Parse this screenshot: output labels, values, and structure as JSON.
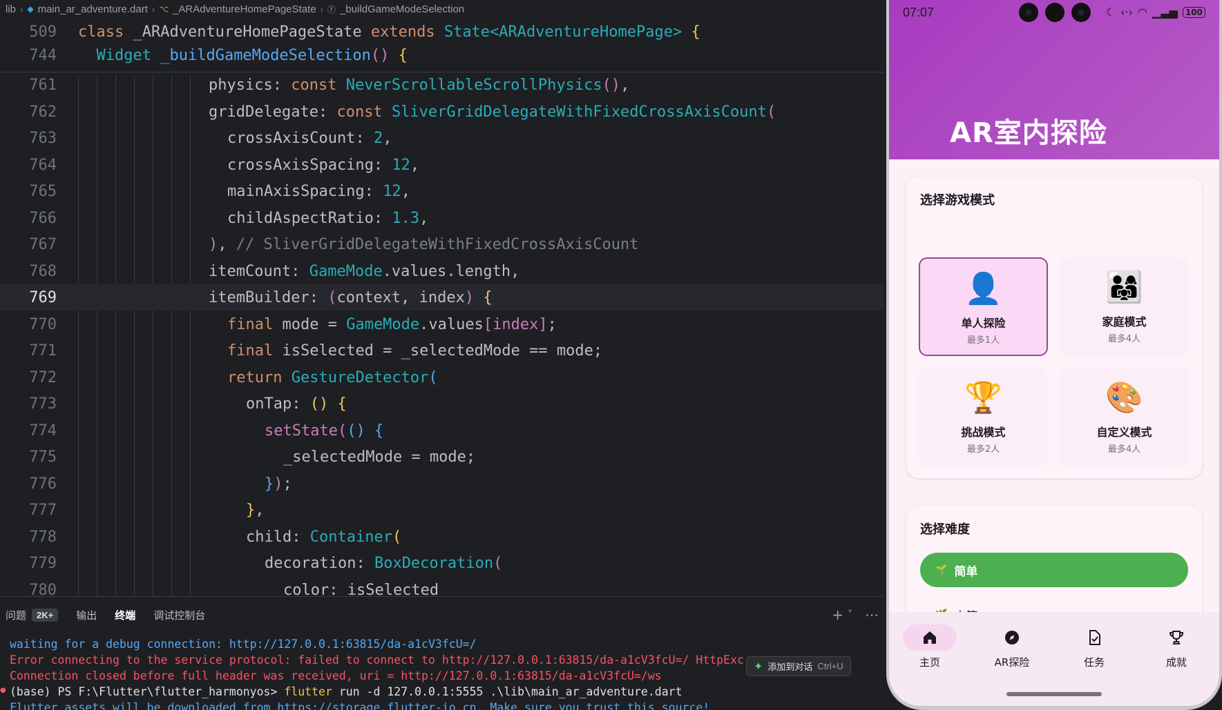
{
  "breadcrumb": {
    "root": "lib",
    "file": "main_ar_adventure.dart",
    "class": "_ARAdventureHomePageState",
    "method": "_buildGameModeSelection"
  },
  "code": {
    "sticky": [
      {
        "ln": "509",
        "text": "class _ARAdventureHomePageState extends State<ARAdventureHomePage> {"
      },
      {
        "ln": "744",
        "text": "  Widget _buildGameModeSelection() {"
      }
    ],
    "lines": [
      {
        "ln": "761"
      },
      {
        "ln": "762"
      },
      {
        "ln": "763"
      },
      {
        "ln": "764"
      },
      {
        "ln": "765"
      },
      {
        "ln": "766"
      },
      {
        "ln": "767"
      },
      {
        "ln": "768"
      },
      {
        "ln": "769"
      },
      {
        "ln": "770"
      },
      {
        "ln": "771"
      },
      {
        "ln": "772"
      },
      {
        "ln": "773"
      },
      {
        "ln": "774"
      },
      {
        "ln": "775"
      },
      {
        "ln": "776"
      },
      {
        "ln": "777"
      },
      {
        "ln": "778"
      },
      {
        "ln": "779"
      },
      {
        "ln": "780"
      }
    ],
    "tokens": {
      "t509_kw": "class",
      "t509_cls": " _ARAdventureHomePageState ",
      "t509_ext": "extends",
      "t509_st": " State<ARAdventureHomePage> ",
      "t509_b": "{",
      "t744_ty": "Widget",
      "t744_fn": " _buildGameModeSelection",
      "t744_p": "()",
      "t744_b": " {",
      "t761_a": "physics",
      "t761_b": ": ",
      "t761_c": "const",
      "t761_d": " NeverScrollableScrollPhysics",
      "t761_e": "()",
      "t761_f": ",",
      "t762_a": "gridDelegate",
      "t762_b": ": ",
      "t762_c": "const",
      "t762_d": " SliverGridDelegateWithFixedCrossAxisCount",
      "t762_e": "(",
      "t763_a": "crossAxisCount",
      "t763_b": ": ",
      "t763_c": "2",
      "t763_d": ",",
      "t764_a": "crossAxisSpacing",
      "t764_b": ": ",
      "t764_c": "12",
      "t764_d": ",",
      "t765_a": "mainAxisSpacing",
      "t765_b": ": ",
      "t765_c": "12",
      "t765_d": ",",
      "t766_a": "childAspectRatio",
      "t766_b": ": ",
      "t766_c": "1.3",
      "t766_d": ",",
      "t767_a": ")",
      "t767_b": ", ",
      "t767_c": "// SliverGridDelegateWithFixedCrossAxisCount",
      "t768_a": "itemCount",
      "t768_b": ": ",
      "t768_c": "GameMode",
      "t768_d": ".values.length,",
      "t769_a": "itemBuilder",
      "t769_b": ": ",
      "t769_c": "(",
      "t769_d": "context, index",
      "t769_e": ")",
      "t769_f": " {",
      "t770_a": "final",
      "t770_b": " mode = ",
      "t770_c": "GameMode",
      "t770_d": ".values",
      "t770_e": "[",
      "t770_f": "index",
      "t770_g": "]",
      "t770_h": ";",
      "t771_a": "final",
      "t771_b": " isSelected = _selectedMode == mode;",
      "t772_a": "return",
      "t772_b": " GestureDetector",
      "t772_c": "(",
      "t773_a": "onTap",
      "t773_b": ": ",
      "t773_c": "()",
      "t773_d": " {",
      "t774_a": "setState",
      "t774_b": "(",
      "t774_c": "()",
      "t774_d": " {",
      "t775_a": "_selectedMode = mode;",
      "t776_a": "}",
      "t776_b": ")",
      "t776_c": ";",
      "t777_a": "}",
      "t777_b": ",",
      "t778_a": "child",
      "t778_b": ": ",
      "t778_c": "Container",
      "t778_d": "(",
      "t779_a": "decoration",
      "t779_b": ": ",
      "t779_c": "BoxDecoration",
      "t779_d": "(",
      "t780_a": "color",
      "t780_b": ": isSelected"
    }
  },
  "panel": {
    "tabs": [
      {
        "label": "问题",
        "badge": "2K+"
      },
      {
        "label": "输出"
      },
      {
        "label": "终端",
        "active": true
      },
      {
        "label": "调试控制台"
      }
    ],
    "actions": {
      "add": "+",
      "dropdown": "˅",
      "more": "⋯"
    },
    "terminal": [
      "waiting for a debug connection: http://127.0.0.1:63815/da-a1cV3fcU=/",
      "Error connecting to the service protocol: failed to connect to http://127.0.0.1:63815/da-a1cV3fcU=/ HttpExc",
      "Connection closed before full header was received, uri = http://127.0.0.1:63815/da-a1cV3fcU=/ws",
      "(base) PS F:\\Flutter\\flutter_harmonyos> ",
      "flutter",
      " run -d 127.0.0.1:5555 .\\lib\\main_ar_adventure.dart",
      "Flutter assets will be downloaded from https://storage.flutter-io.cn. Make sure you trust this source!"
    ],
    "add_chat": {
      "label": "添加到对话",
      "shortcut": "Ctrl+U"
    }
  },
  "phone": {
    "status": {
      "time": "07:07",
      "battery": "100"
    },
    "title": "AR室内探险",
    "mode_section": {
      "title": "选择游戏模式",
      "modes": [
        {
          "emoji": "👤",
          "name": "单人探险",
          "sub": "最多1人",
          "selected": true
        },
        {
          "emoji": "👨‍👩‍👧",
          "name": "家庭模式",
          "sub": "最多4人"
        },
        {
          "emoji": "🏆",
          "name": "挑战模式",
          "sub": "最多2人"
        },
        {
          "emoji": "🎨",
          "name": "自定义模式",
          "sub": "最多4人"
        }
      ]
    },
    "difficulty": {
      "title": "选择难度",
      "options": [
        {
          "emoji": "🌱",
          "label": "简单",
          "selected": true
        },
        {
          "emoji": "🌿",
          "label": "中等"
        }
      ]
    },
    "nav": [
      {
        "icon": "home-icon",
        "label": "主页",
        "active": true
      },
      {
        "icon": "compass-icon",
        "label": "AR探险"
      },
      {
        "icon": "task-icon",
        "label": "任务"
      },
      {
        "icon": "trophy-icon",
        "label": "成就"
      }
    ],
    "colors": {
      "header": "#a83bc0",
      "selected_border": "#8c4e91",
      "easy_green": "#4caf50"
    }
  }
}
